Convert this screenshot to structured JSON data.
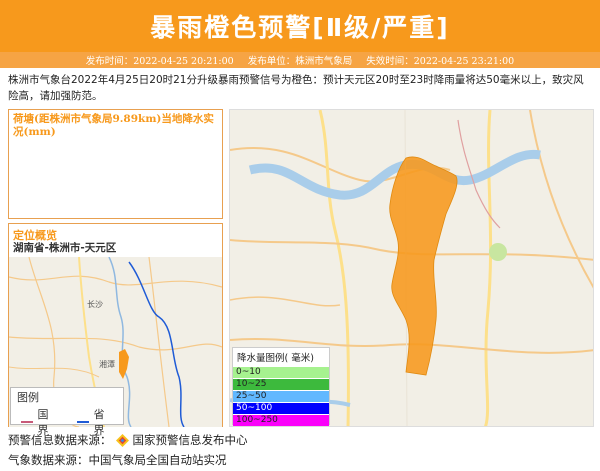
{
  "header": {
    "title": "暴雨橙色预警[Ⅱ级/严重]"
  },
  "meta": {
    "publish_time": "发布时间：2022-04-25 20:21:00",
    "publisher": "发布单位：株洲市气象局",
    "expire_time": "失效时间：2022-04-25 23:21:00"
  },
  "description": "株洲市气象台2022年4月25日20时21分升级暴雨预警信号为橙色：预计天元区20时至23时降雨量将达50毫米以上，致灾风险高，请加强防范。",
  "rain_panel": {
    "title": "荷塘(距株洲市气象局9.89km)当地降水实况(mm)"
  },
  "location_panel": {
    "title": "定位概览",
    "region": "湖南省-株洲市-天元区",
    "map_labels": {
      "changsha": "长沙",
      "xiangtan": "湘潭"
    }
  },
  "map_legend": {
    "title": "图例",
    "items": [
      {
        "label": "国界",
        "color": "#c85a78"
      },
      {
        "label": "省界",
        "color": "#1f5bd6"
      }
    ]
  },
  "rain_legend": {
    "title": "降水量图例( 毫米)",
    "items": [
      {
        "label": "0~10",
        "color": "#a6f28f"
      },
      {
        "label": "10~25",
        "color": "#3dba3d"
      },
      {
        "label": "25~50",
        "color": "#61b8ff"
      },
      {
        "label": "50~100",
        "color": "#0000fe"
      },
      {
        "label": "100~250",
        "color": "#fa00fa"
      }
    ]
  },
  "footer": {
    "warning_source": "预警信息数据来源：",
    "warning_source_name": "国家预警信息发布中心",
    "weather_source": "气象数据来源：中国气象局全国自动站实况"
  },
  "colors": {
    "accent": "#f7991c",
    "warning_area": "#f7991c"
  }
}
